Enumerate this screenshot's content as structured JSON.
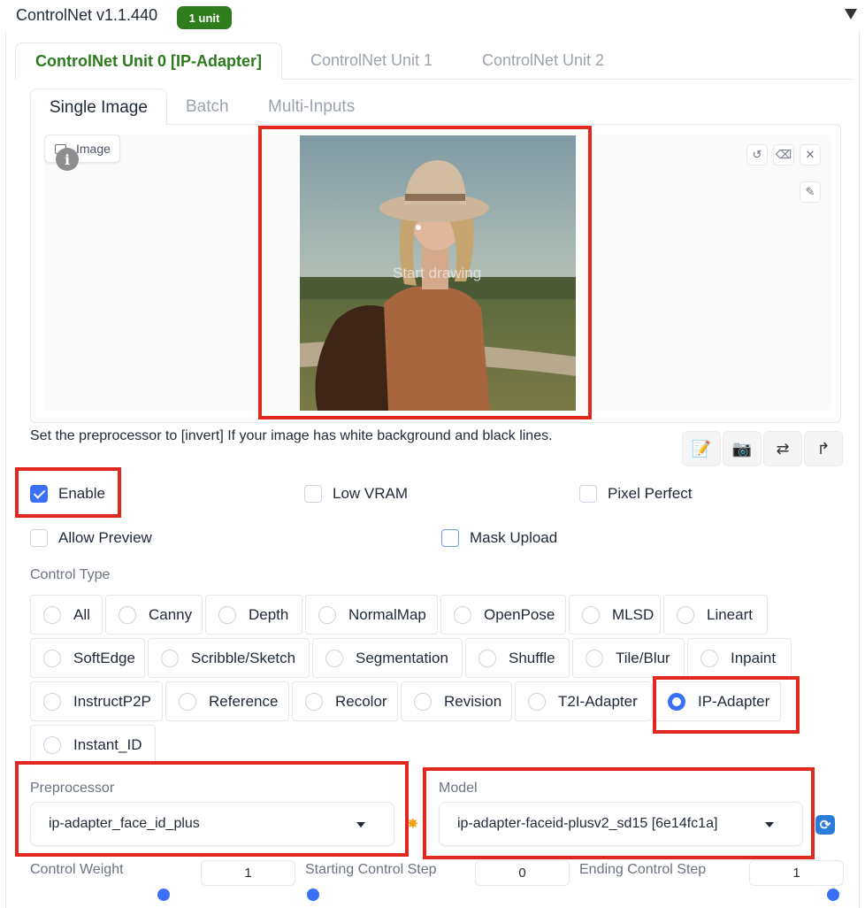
{
  "header": {
    "title": "ControlNet v1.1.440",
    "badge": "1 unit"
  },
  "unit_tabs": [
    {
      "label": "ControlNet Unit 0 [IP-Adapter]"
    },
    {
      "label": "ControlNet Unit 1"
    },
    {
      "label": "ControlNet Unit 2"
    }
  ],
  "mode_tabs": [
    {
      "label": "Single Image"
    },
    {
      "label": "Batch"
    },
    {
      "label": "Multi-Inputs"
    }
  ],
  "image_panel": {
    "label": "Image",
    "info_glyph": "i",
    "placeholder": "Start drawing"
  },
  "hint": "Set the preprocessor to [invert] If your image has white background and black lines.",
  "checkboxes": {
    "enable": {
      "label": "Enable",
      "checked": true
    },
    "low_vram": {
      "label": "Low VRAM",
      "checked": false
    },
    "pixel_perfect": {
      "label": "Pixel Perfect",
      "checked": false
    },
    "allow_preview": {
      "label": "Allow Preview",
      "checked": false
    },
    "mask_upload": {
      "label": "Mask Upload",
      "checked": false
    }
  },
  "control_type": {
    "label": "Control Type",
    "options": [
      "All",
      "Canny",
      "Depth",
      "NormalMap",
      "OpenPose",
      "MLSD",
      "Lineart",
      "SoftEdge",
      "Scribble/Sketch",
      "Segmentation",
      "Shuffle",
      "Tile/Blur",
      "Inpaint",
      "InstructP2P",
      "Reference",
      "Recolor",
      "Revision",
      "T2I-Adapter",
      "IP-Adapter",
      "Instant_ID"
    ],
    "selected": "IP-Adapter"
  },
  "preprocessor": {
    "label": "Preprocessor",
    "value": "ip-adapter_face_id_plus"
  },
  "model": {
    "label": "Model",
    "value": "ip-adapter-faceid-plusv2_sd15 [6e14fc1a]"
  },
  "sliders": {
    "control_weight": {
      "label": "Control Weight",
      "value": "1"
    },
    "starting_step": {
      "label": "Starting Control Step",
      "value": "0"
    },
    "ending_step": {
      "label": "Ending Control Step",
      "value": "1"
    }
  },
  "colors": {
    "accent": "#3b6ff5",
    "badge": "#2f7d1c",
    "active_tab": "#2d7a1e",
    "highlight": "#e0281e"
  }
}
